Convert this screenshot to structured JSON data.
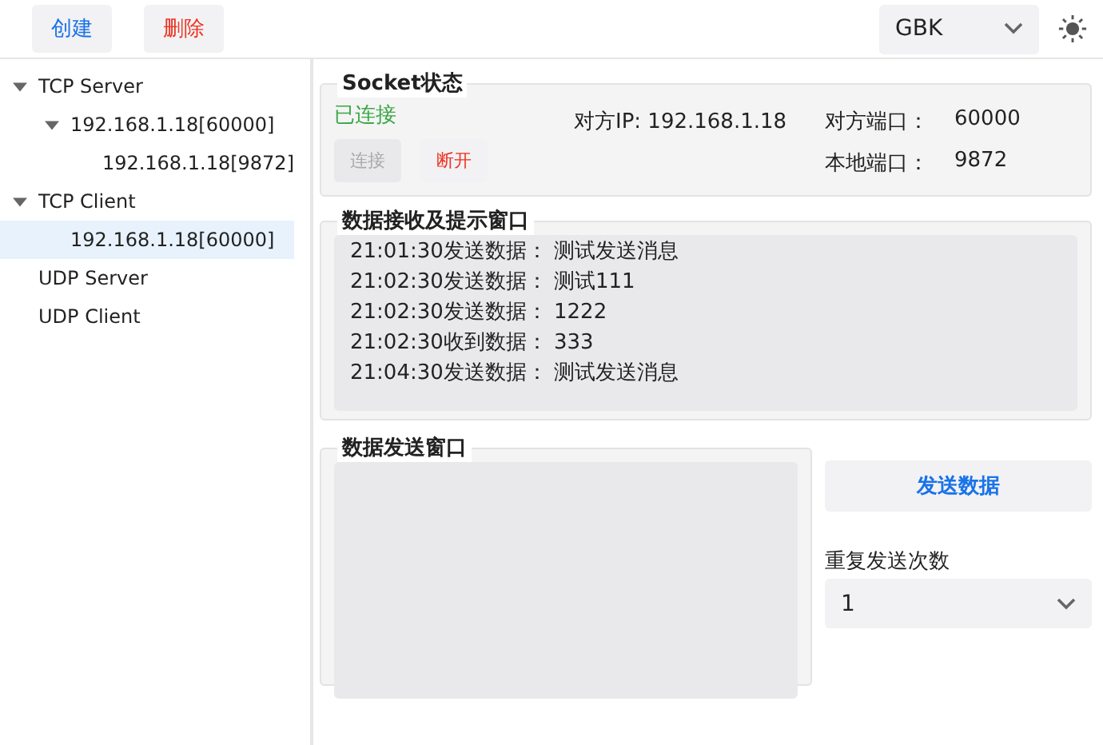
{
  "toolbar": {
    "buttons": [
      {
        "label": "创建",
        "kind": "create"
      },
      {
        "label": "删除",
        "kind": "delete"
      }
    ],
    "encoding": "GBK"
  },
  "tree": [
    {
      "label": "TCP Server",
      "expanded": true,
      "selected": false,
      "children": [
        {
          "label": "192.168.1.18[60000]",
          "expanded": true,
          "selected": false,
          "children": [
            {
              "label": "192.168.1.18[9872]",
              "selected": false
            }
          ]
        }
      ]
    },
    {
      "label": "TCP Client",
      "expanded": true,
      "selected": false,
      "children": [
        {
          "label": "192.168.1.18[60000]",
          "selected": true
        }
      ]
    },
    {
      "label": "UDP Server",
      "selected": false
    },
    {
      "label": "UDP Client",
      "selected": false
    }
  ],
  "socket": {
    "title": "Socket状态",
    "status": "已连接",
    "connected": true,
    "buttons": [
      {
        "label": "连接",
        "kind": "connect",
        "disabled": true
      },
      {
        "label": "断开",
        "kind": "disconnect",
        "disabled": false
      }
    ],
    "peer_ip": "对方IP: 192.168.1.18",
    "fields": [
      {
        "label": "对方端口：",
        "value": "60000"
      },
      {
        "label": "本地端口：",
        "value": "9872"
      }
    ]
  },
  "receive": {
    "title": "数据接收及提示窗口",
    "lines": [
      "21:01:30发送数据： 测试发送消息",
      "21:02:30发送数据： 测试111",
      "21:02:30发送数据： 1222",
      "21:02:30收到数据： 333",
      "21:04:30发送数据： 测试发送消息"
    ]
  },
  "send": {
    "title": "数据发送窗口",
    "button": "发送数据",
    "repeat_label": "重复发送次数",
    "repeat_value": "1"
  }
}
